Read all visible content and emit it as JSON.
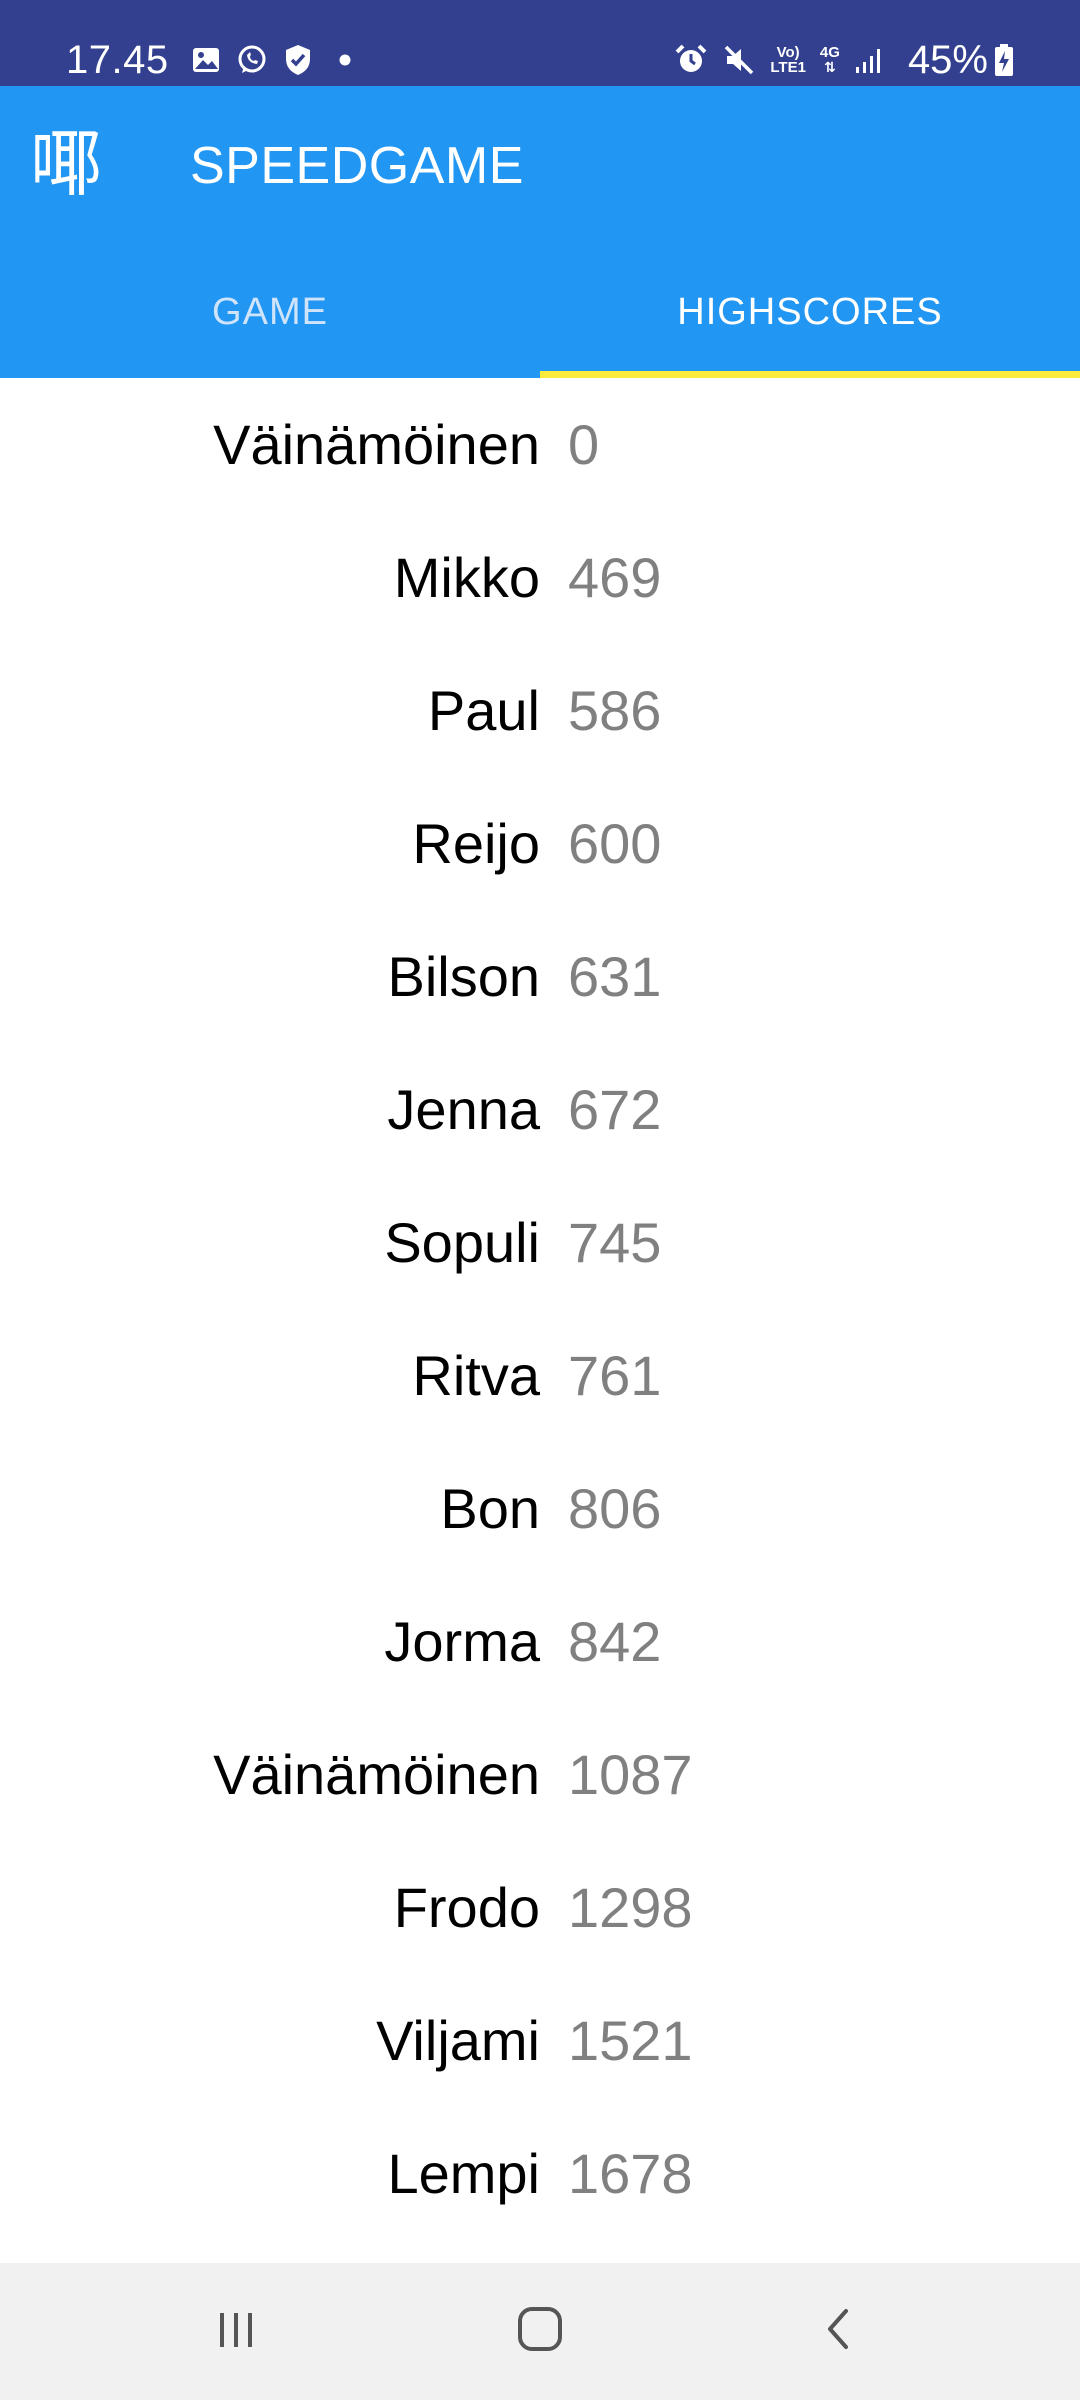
{
  "status_bar": {
    "time": "17.45",
    "battery_percent": "45%",
    "network_label_top": "Vo)",
    "network_label_bottom": "LTE1",
    "network_type": "4G",
    "notification_icons": [
      "gallery-icon",
      "whatsapp-icon",
      "shield-check-icon",
      "dot-icon"
    ],
    "system_icons": [
      "alarm-icon",
      "mute-icon",
      "volte-icon",
      "4g-data-icon",
      "signal-icon",
      "battery-charging-icon"
    ]
  },
  "app_bar": {
    "icon": "ideograph-app-icon",
    "icon_glyph": "㖿",
    "title": "SPEEDGAME"
  },
  "tabs": [
    {
      "label": "GAME",
      "selected": false
    },
    {
      "label": "HIGHSCORES",
      "selected": true
    }
  ],
  "highscores": [
    {
      "name": "Väinämöinen",
      "score": "0"
    },
    {
      "name": "Mikko",
      "score": "469"
    },
    {
      "name": "Paul",
      "score": "586"
    },
    {
      "name": "Reijo",
      "score": "600"
    },
    {
      "name": "Bilson",
      "score": "631"
    },
    {
      "name": "Jenna",
      "score": "672"
    },
    {
      "name": "Sopuli",
      "score": "745"
    },
    {
      "name": "Ritva",
      "score": "761"
    },
    {
      "name": "Bon",
      "score": "806"
    },
    {
      "name": "Jorma",
      "score": "842"
    },
    {
      "name": "Väinämöinen",
      "score": "1087"
    },
    {
      "name": "Frodo",
      "score": "1298"
    },
    {
      "name": "Viljami",
      "score": "1521"
    },
    {
      "name": "Lempi",
      "score": "1678"
    }
  ],
  "nav_bar": {
    "buttons": [
      "recents-icon",
      "home-icon",
      "back-icon"
    ]
  },
  "colors": {
    "status_bar": "#32408f",
    "app_bar": "#2196f3",
    "tab_indicator": "#ffeb3b",
    "score_value": "#808080",
    "nav_bar": "#f1f1f1"
  }
}
